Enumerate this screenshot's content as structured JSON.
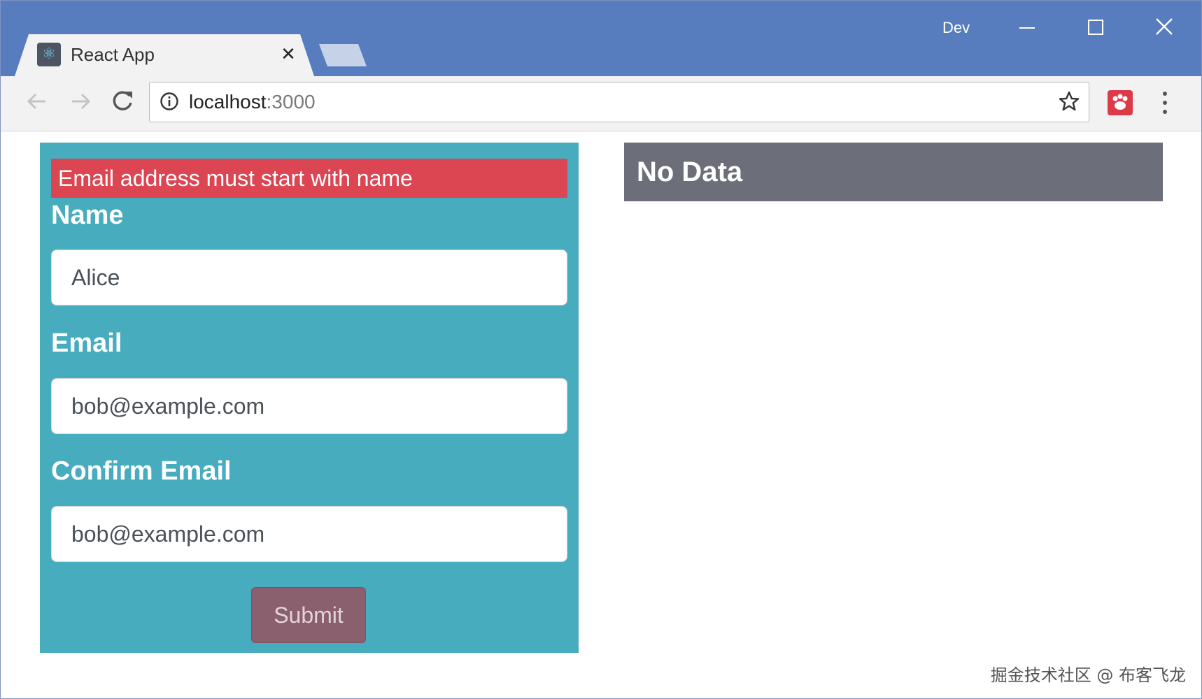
{
  "browser": {
    "tab_title": "React App",
    "tab_close": "✕",
    "profile_label": "Dev",
    "url_host": "localhost",
    "url_port": ":3000"
  },
  "form": {
    "error_message": "Email address must start with name",
    "name_label": "Name",
    "name_value": "Alice",
    "email_label": "Email",
    "email_value": "bob@example.com",
    "confirm_label": "Confirm Email",
    "confirm_value": "bob@example.com",
    "submit_label": "Submit"
  },
  "summary": {
    "title": "No Data"
  },
  "watermark": "掘金技术社区 @ 布客飞龙",
  "colors": {
    "titlebar": "#587dbf",
    "form_panel": "#47acbd",
    "error_banner": "#dc4552",
    "nodata_panel": "#6c6f79",
    "submit_button": "#8a5f6e"
  }
}
